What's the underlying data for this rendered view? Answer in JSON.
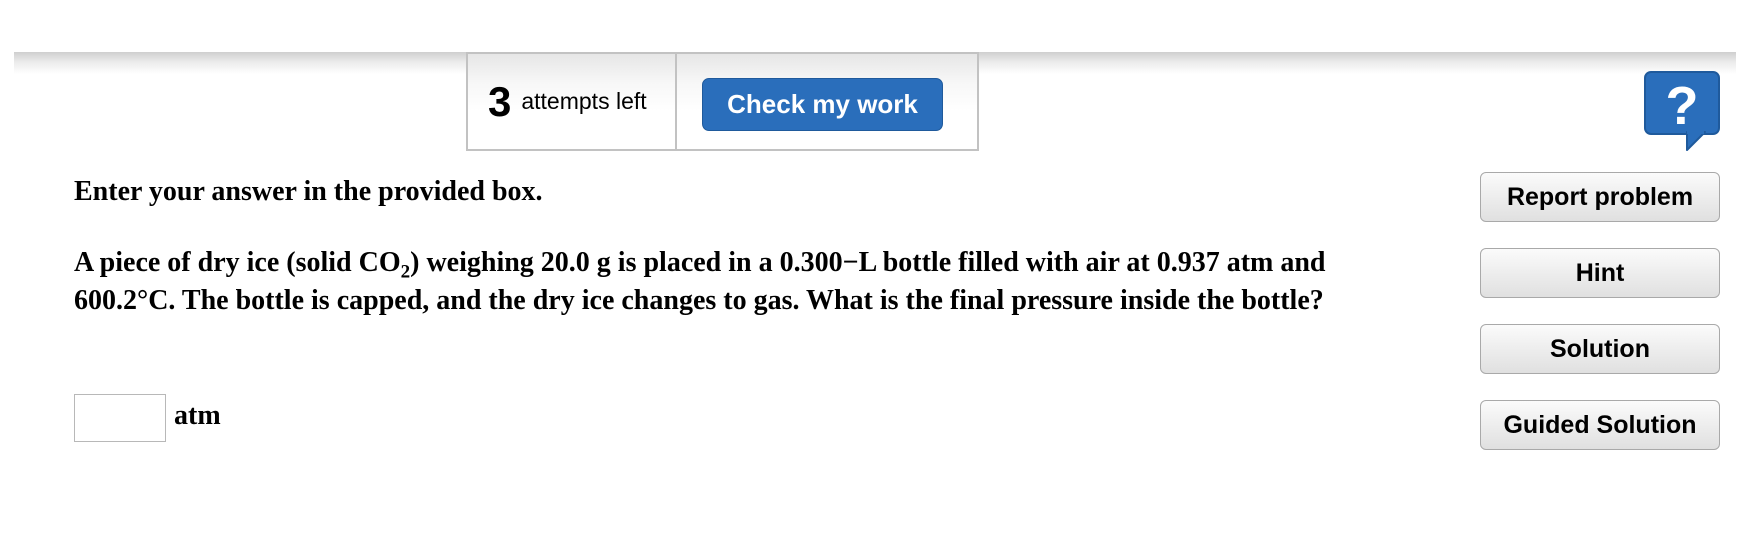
{
  "toolbar": {
    "attempts_count": "3",
    "attempts_label": "attempts left",
    "check_label": "Check my work"
  },
  "help": {
    "icon": "question-mark-speech-bubble-icon",
    "glyph": "?",
    "color": "#2a6ebb"
  },
  "question": {
    "instruction": "Enter your answer in the provided box.",
    "text_part1": "A piece of dry ice (solid CO",
    "subscript": "2",
    "text_part2": ") weighing 20.0 g is placed in a 0.300−L bottle filled with air at 0.937 atm and 600.2°C. The bottle is capped, and the dry ice changes to gas. What is the final pressure inside the bottle?"
  },
  "answer": {
    "value": "",
    "unit": "atm"
  },
  "sidebar": {
    "buttons": [
      {
        "label": "Report problem"
      },
      {
        "label": "Hint"
      },
      {
        "label": "Solution"
      },
      {
        "label": "Guided Solution"
      }
    ]
  },
  "colors": {
    "accent": "#2a6ebb",
    "border": "#c2c2c2"
  }
}
